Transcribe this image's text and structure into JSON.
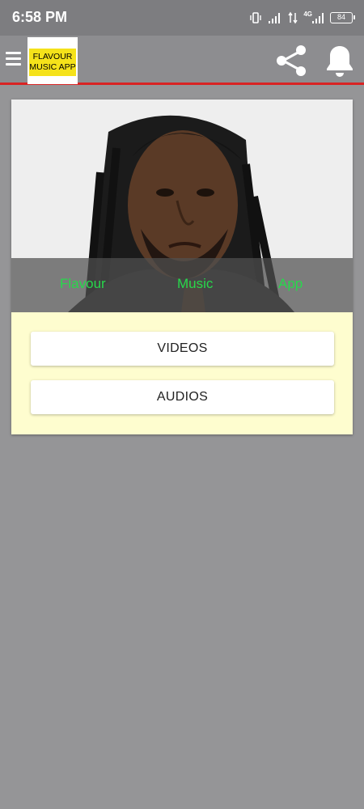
{
  "status_bar": {
    "time": "6:58 PM",
    "network_label": "4G",
    "battery": "84",
    "icons": [
      "vibrate-icon",
      "signal-icon",
      "data-arrows-icon",
      "signal-icon",
      "battery-icon"
    ]
  },
  "toolbar": {
    "logo_line1": "FLAVOUR",
    "logo_line2": "MUSIC APP",
    "icons": [
      "menu-icon",
      "share-icon",
      "bell-icon"
    ],
    "accent_color": "#d92323",
    "logo_color": "#f5e21a"
  },
  "hero": {
    "caption_words": [
      "Flavour",
      "Music",
      "App"
    ],
    "caption_color": "#27d84b"
  },
  "buttons": {
    "videos": "VIDEOS",
    "audios": "AUDIOS"
  },
  "card_color": "#fefdcf"
}
